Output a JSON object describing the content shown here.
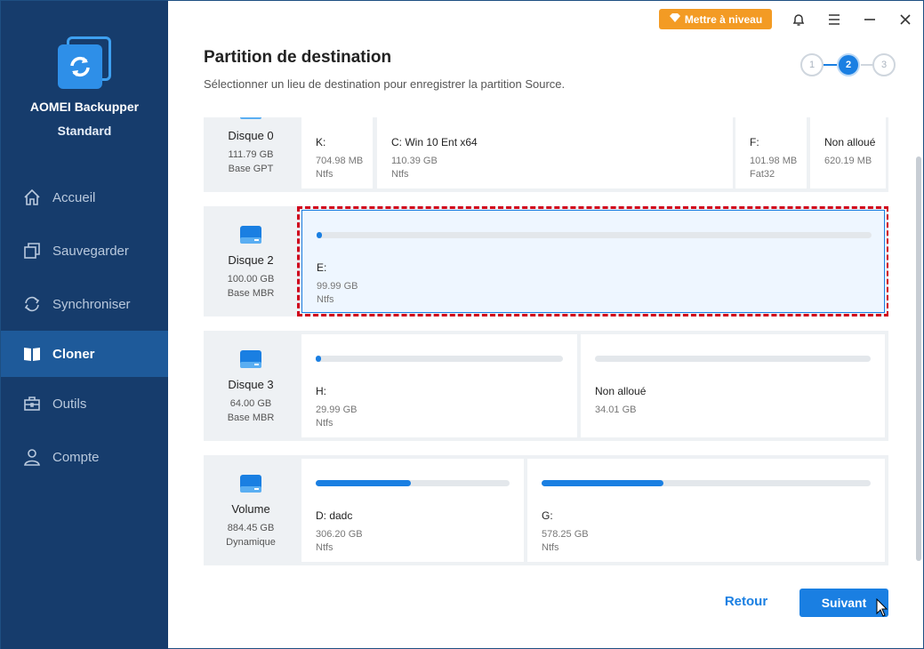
{
  "app": {
    "name": "AOMEI Backupper",
    "edition": "Standard"
  },
  "nav": [
    {
      "label": "Accueil",
      "icon": "home-icon",
      "active": false
    },
    {
      "label": "Sauvegarder",
      "icon": "backup-icon",
      "active": false
    },
    {
      "label": "Synchroniser",
      "icon": "sync-icon",
      "active": false
    },
    {
      "label": "Cloner",
      "icon": "clone-icon",
      "active": true
    },
    {
      "label": "Outils",
      "icon": "toolbox-icon",
      "active": false
    },
    {
      "label": "Compte",
      "icon": "user-icon",
      "active": false
    }
  ],
  "topbar": {
    "upgrade_label": "Mettre à niveau"
  },
  "header": {
    "title": "Partition de destination",
    "subtitle": "Sélectionner un lieu de destination pour enregistrer la partition Source."
  },
  "steps": [
    "1",
    "2",
    "3"
  ],
  "active_step": 2,
  "disks": [
    {
      "name": "Disque 0",
      "size": "111.79 GB",
      "type": "Base GPT",
      "partitions": [
        {
          "name": "K:",
          "size": "704.98 MB",
          "fs": "Ntfs"
        },
        {
          "name": "C: Win 10 Ent x64",
          "size": "110.39 GB",
          "fs": "Ntfs"
        },
        {
          "name": "F:",
          "size": "101.98 MB",
          "fs": "Fat32"
        },
        {
          "name": "Non alloué",
          "size": "620.19 MB",
          "fs": ""
        }
      ]
    },
    {
      "name": "Disque 2",
      "size": "100.00 GB",
      "type": "Base MBR",
      "partitions": [
        {
          "name": "E:",
          "size": "99.99 GB",
          "fs": "Ntfs",
          "used": 0.008,
          "selected": true
        }
      ]
    },
    {
      "name": "Disque 3",
      "size": "64.00 GB",
      "type": "Base MBR",
      "partitions": [
        {
          "name": "H:",
          "size": "29.99 GB",
          "fs": "Ntfs",
          "used": 0.02
        },
        {
          "name": "Non alloué",
          "size": "34.01 GB",
          "fs": "",
          "used": 0
        }
      ]
    },
    {
      "name": "Volume",
      "size": "884.45 GB",
      "type": "Dynamique",
      "partitions": [
        {
          "name": "D: dadc",
          "size": "306.20 GB",
          "fs": "Ntfs",
          "used": 0.49
        },
        {
          "name": "G:",
          "size": "578.25 GB",
          "fs": "Ntfs",
          "used": 0.37
        }
      ]
    }
  ],
  "buttons": {
    "back": "Retour",
    "next": "Suivant"
  },
  "colors": {
    "sidebar": "#163c6c",
    "accent": "#1a7fe2",
    "upgrade": "#f39b24",
    "selection_outline": "#d0021b"
  }
}
